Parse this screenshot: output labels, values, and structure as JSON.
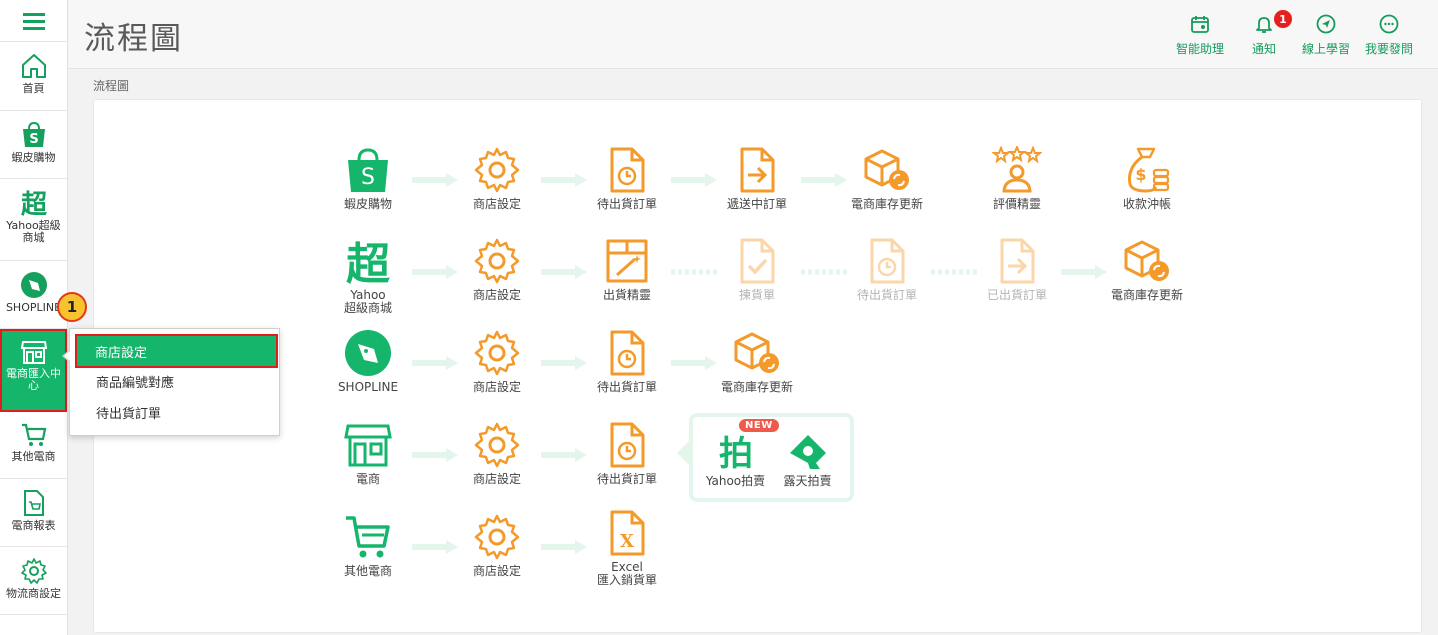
{
  "page": {
    "title": "流程圖",
    "breadcrumb": "流程圖"
  },
  "topbar": {
    "actions": [
      {
        "label": "智能助理",
        "icon": "calendar-icon"
      },
      {
        "label": "通知",
        "icon": "bell-icon",
        "badge": "1"
      },
      {
        "label": "線上學習",
        "icon": "navigation-icon"
      },
      {
        "label": "我要發問",
        "icon": "chat-icon"
      }
    ]
  },
  "sidebar": {
    "items": [
      {
        "label": "首頁",
        "icon": "home-icon"
      },
      {
        "label": "蝦皮購物",
        "icon": "shopee-icon"
      },
      {
        "label": "Yahoo超級商城",
        "icon": "yahoo-mall-icon"
      },
      {
        "label": "SHOPLINE",
        "icon": "shopline-icon"
      },
      {
        "label": "電商匯入中心",
        "icon": "store-icon"
      },
      {
        "label": "其他電商",
        "icon": "cart-icon"
      },
      {
        "label": "電商報表",
        "icon": "report-icon"
      },
      {
        "label": "物流商設定",
        "icon": "gear-icon"
      }
    ]
  },
  "submenu": {
    "step": "1",
    "items": [
      {
        "label": "商店設定",
        "selected": true
      },
      {
        "label": "商品編號對應",
        "selected": false
      },
      {
        "label": "待出貨訂單",
        "selected": false
      }
    ]
  },
  "flow": {
    "rows": [
      {
        "nodes": [
          {
            "label": "蝦皮購物"
          },
          {
            "label": "商店設定"
          },
          {
            "label": "待出貨訂單"
          },
          {
            "label": "遞送中訂單"
          },
          {
            "label": "電商庫存更新"
          },
          {
            "label": "評價精靈"
          },
          {
            "label": "收款沖帳"
          }
        ]
      },
      {
        "nodes": [
          {
            "label_line1": "Yahoo",
            "label_line2": "超級商城"
          },
          {
            "label": "商店設定"
          },
          {
            "label": "出貨精靈"
          },
          {
            "label": "揀貨單"
          },
          {
            "label": "待出貨訂單"
          },
          {
            "label": "已出貨訂單"
          },
          {
            "label": "電商庫存更新"
          }
        ]
      },
      {
        "nodes": [
          {
            "label": "SHOPLINE"
          },
          {
            "label": "商店設定"
          },
          {
            "label": "待出貨訂單"
          },
          {
            "label": "電商庫存更新"
          }
        ]
      },
      {
        "nodes": [
          {
            "label": "電商"
          },
          {
            "label": "商店設定"
          },
          {
            "label": "待出貨訂單"
          }
        ],
        "bubble": {
          "new_badge": "NEW",
          "items": [
            {
              "label": "Yahoo拍賣"
            },
            {
              "label": "露天拍賣"
            }
          ]
        }
      },
      {
        "nodes": [
          {
            "label": "其他電商"
          },
          {
            "label": "商店設定"
          },
          {
            "label_line1": "Excel",
            "label_line2": "匯入銷貨單"
          }
        ]
      }
    ]
  },
  "colors": {
    "brand_green": "#15b56b",
    "orange": "#f39a2b",
    "arrow": "#e4f5ec",
    "alert_red": "#e21d1d"
  }
}
